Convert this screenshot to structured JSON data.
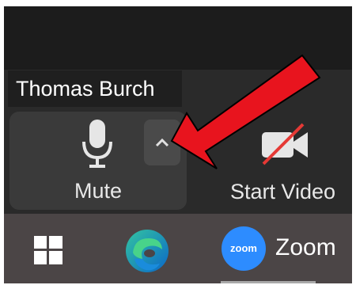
{
  "participant": {
    "name": "Thomas Burch"
  },
  "toolbar": {
    "mute_label": "Mute",
    "mute_icon": "microphone-icon",
    "audio_options_icon": "chevron-up-icon",
    "start_video_label": "Start Video",
    "video_icon": "video-off-icon"
  },
  "annotation": {
    "arrow_color": "#e8141e",
    "pointing_to": "audio-options-button"
  },
  "taskbar": {
    "start_icon": "windows-logo-icon",
    "edge_icon": "edge-icon",
    "zoom_logo_text": "zoom",
    "zoom_label": "Zoom"
  }
}
